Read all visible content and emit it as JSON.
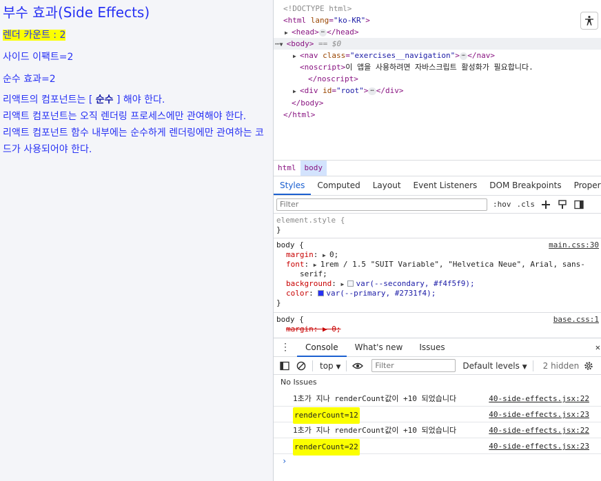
{
  "page": {
    "title": "부수 효과(Side Effects)",
    "render_count": "렌더 카운트 : 2",
    "side_effect": "사이드 이팩트=2",
    "pure_effect": "순수 효과=2",
    "para1_pre": "리액트의 컴포넌트는 [ ",
    "para1_bold": "순수",
    "para1_post": " ] 해야 한다.",
    "para2": "리액트 컴포넌트는 오직 렌더링 프로세스에만 관여해야 한다.",
    "para3": "리액트 컴포넌트 함수 내부에는 순수하게 렌더링에만 관여하는 코드가 사용되어야 한다."
  },
  "devtools": {
    "dom": {
      "doctype": "<!DOCTYPE html>",
      "html_open_tag": "<html",
      "lang_attr": "lang",
      "lang_val": "\"ko-KR\"",
      "html_close_bracket": ">",
      "head": "<head>",
      "head_close": "</head>",
      "body": "<body>",
      "body_marker": "== $0",
      "nav_open": "<nav",
      "nav_attr": "class",
      "nav_val": "\"exercises__navigation\"",
      "nav_close": "</nav>",
      "noscript_open": "<noscript>",
      "noscript_text": "이 앱을 사용하려면 자바스크립트 활성화가 필요합니다.",
      "noscript_close": "</noscript>",
      "div_open": "<div",
      "div_attr": "id",
      "div_val": "\"root\"",
      "div_close": "</div>",
      "body_close": "</body>",
      "html_close": "</html>",
      "ellipsis": "⋯",
      "row_dots": "⋯"
    },
    "breadcrumb": [
      "html",
      "body"
    ],
    "styles_tabs": [
      "Styles",
      "Computed",
      "Layout",
      "Event Listeners",
      "DOM Breakpoints",
      "Properties"
    ],
    "styles_more": ">",
    "filter_placeholder": "Filter",
    "hov": ":hov",
    "cls": ".cls",
    "element_style": "element.style {",
    "close_brace": "}",
    "rule1": {
      "selector": "body {",
      "source": "main.css:30",
      "margin_prop": "margin",
      "margin_val": "0;",
      "font_prop": "font",
      "font_val": "1rem / 1.5 \"SUIT Variable\", \"Helvetica Neue\", Arial, sans-",
      "font_val2": "serif;",
      "bg_prop": "background",
      "bg_val": "var(--secondary, #f4f5f9);",
      "bg_color": "#f4f5f9",
      "color_prop": "color",
      "color_val": "var(--primary, #2731f4);",
      "primary_color": "#2731f4"
    },
    "rule2": {
      "selector": "body {",
      "source": "base.css:1",
      "margin_prop": "margin",
      "margin_val": "0;"
    },
    "console_tabs": [
      "Console",
      "What's new",
      "Issues"
    ],
    "console_close": "✕",
    "context": "top",
    "console_filter": "Filter",
    "levels": "Default levels",
    "hidden": "2 hidden",
    "no_issues": "No Issues",
    "logs": [
      {
        "msg": "1초가 지나 renderCount값이 +10 되었습니다",
        "src": "40-side-effects.jsx:22",
        "hl": false
      },
      {
        "msg": "renderCount=12",
        "src": "40-side-effects.jsx:23",
        "hl": true
      },
      {
        "msg": "1초가 지나 renderCount값이 +10 되었습니다",
        "src": "40-side-effects.jsx:22",
        "hl": false
      },
      {
        "msg": "renderCount=22",
        "src": "40-side-effects.jsx:23",
        "hl": true
      }
    ],
    "prompt": "›",
    "highlight_color": "#fbff00"
  }
}
